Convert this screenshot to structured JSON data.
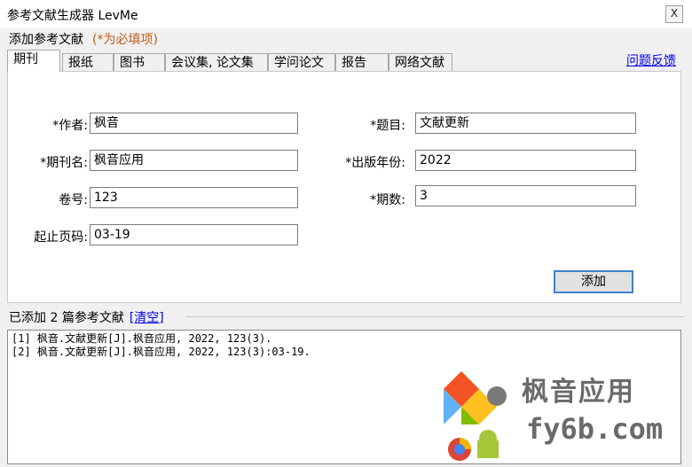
{
  "window": {
    "title": "参考文献生成器  LevMe",
    "close_label": "X"
  },
  "form": {
    "group_title": "添加参考文献",
    "required_note": "(*为必填项)",
    "feedback_link": "问题反馈",
    "tabs": [
      "期刊",
      "报纸",
      "图书",
      "会议集, 论文集",
      "学问论文",
      "报告",
      "网络文献"
    ],
    "fields": {
      "author": {
        "label": "*作者:",
        "value": "枫音"
      },
      "title": {
        "label": "*题目:",
        "value": "文献更新"
      },
      "journal": {
        "label": "*期刊名:",
        "value": "枫音应用"
      },
      "year": {
        "label": "*出版年份:",
        "value": "2022"
      },
      "volume": {
        "label": "卷号:",
        "value": "123"
      },
      "issue": {
        "label": "*期数:",
        "value": "3"
      },
      "pages": {
        "label": "起止页码:",
        "value": "03-19"
      }
    },
    "add_button": "添加"
  },
  "results": {
    "label_prefix": "已添加",
    "count": "2",
    "label_suffix": "篇参考文献",
    "clear_link": "[清空]",
    "lines": [
      "[1] 枫音.文献更新[J].枫音应用, 2022, 123(3).",
      "[2] 枫音.文献更新[J].枫音应用, 2022, 123(3):03-19."
    ]
  },
  "watermark": {
    "brand": "枫音应用",
    "domain": "fy6b.com"
  },
  "colors": {
    "required_note": "#c65a1e",
    "link": "#0000ee",
    "button_border": "#3c7fd0"
  }
}
